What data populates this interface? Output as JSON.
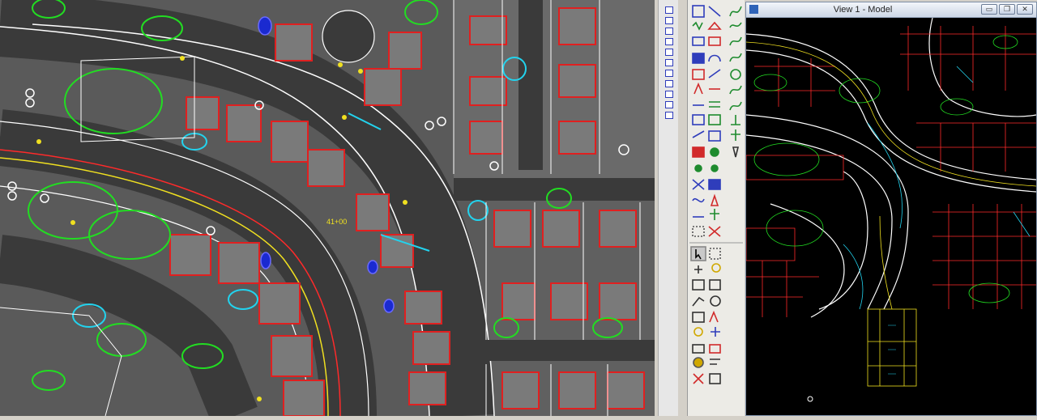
{
  "main_map": {
    "station_label": "41+00"
  },
  "view": {
    "title": "View 1 - Model",
    "buttons": {
      "minimize": "▭",
      "restore": "❐",
      "close": "✕"
    }
  },
  "colors": {
    "road_edge": "#ff2a2a",
    "vegetation": "#22dd22",
    "utility": "#22d3ee",
    "centerline": "#f0e020",
    "lot_line": "#ffffff",
    "building": "#e02020"
  },
  "icons": [
    "pointer-icon",
    "fence-icon",
    "zoom-icon",
    "line-icon",
    "circle-icon",
    "text-icon",
    "delete-icon",
    "move-icon",
    "copy-icon",
    "rotate-icon"
  ]
}
